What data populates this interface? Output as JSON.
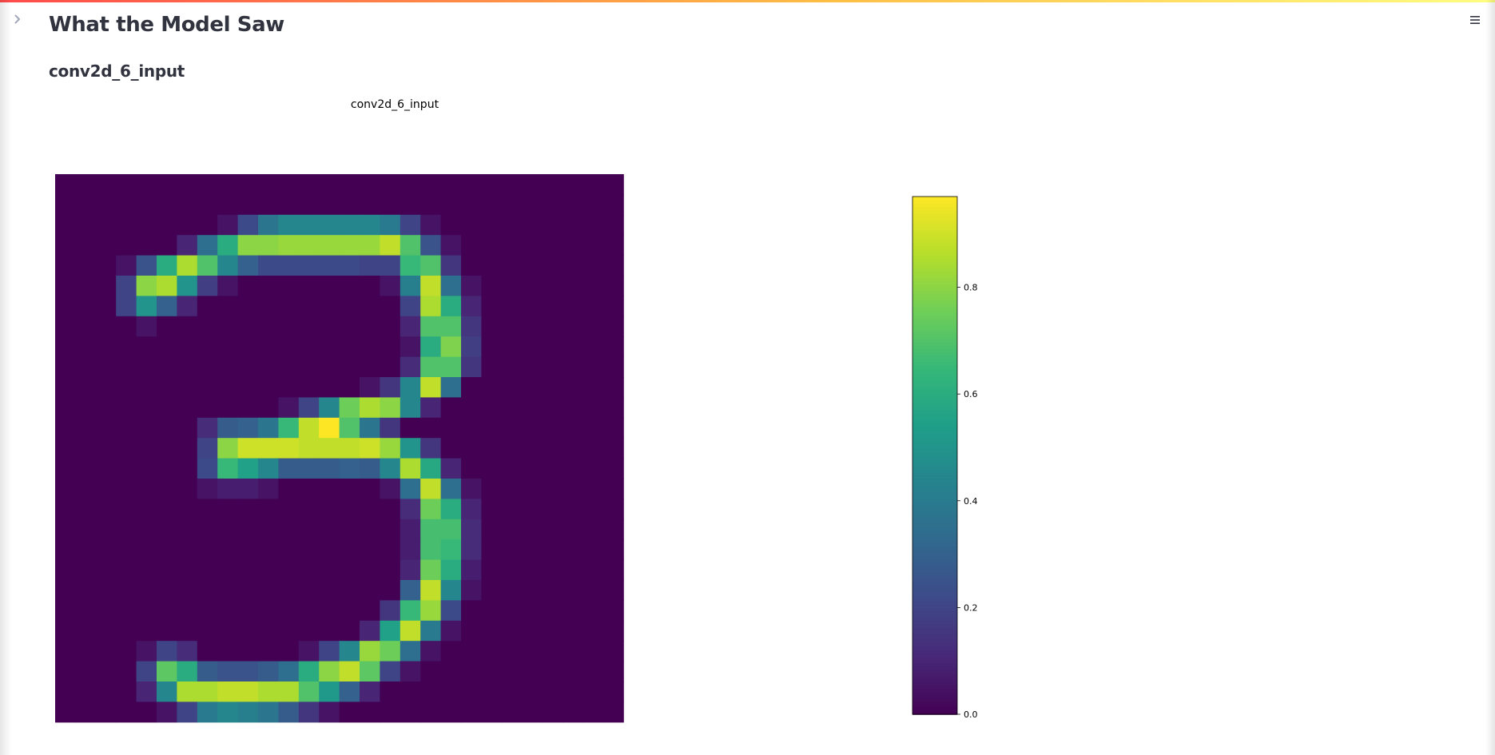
{
  "app": {
    "title": "What the Model Saw",
    "section_heading": "conv2d_6_input"
  },
  "icons": {
    "sidebar_toggle": "chevron-right-icon",
    "main_menu": "hamburger-menu-icon"
  },
  "colors": {
    "accent_gradient": [
      "#ff4b4b",
      "#ffbd45",
      "#fffd80"
    ],
    "text": "#31333f",
    "colormap": "viridis"
  },
  "chart_data": {
    "type": "heatmap",
    "title": "conv2d_6_input",
    "colormap": "viridis",
    "colorbar": {
      "range": [
        0,
        0.97
      ],
      "ticks": [
        0.0,
        0.2,
        0.4,
        0.6,
        0.8
      ],
      "tick_labels": [
        "0.0",
        "0.2",
        "0.4",
        "0.6",
        "0.8"
      ]
    },
    "grid": false,
    "rows": 28,
    "cols": 28,
    "visible_rows": 27,
    "values": [
      [
        0,
        0,
        0,
        0,
        0,
        0,
        0,
        0,
        0,
        0,
        0,
        0,
        0,
        0,
        0,
        0,
        0,
        0,
        0,
        0,
        0,
        0,
        0,
        0,
        0,
        0,
        0,
        0
      ],
      [
        0,
        0,
        0,
        0,
        0,
        0,
        0,
        0,
        0,
        0,
        0,
        0,
        0,
        0,
        0,
        0,
        0,
        0,
        0,
        0,
        0,
        0,
        0,
        0,
        0,
        0,
        0,
        0
      ],
      [
        0,
        0,
        0,
        0,
        0,
        0,
        0,
        0,
        0.05,
        0.22,
        0.38,
        0.45,
        0.45,
        0.45,
        0.45,
        0.45,
        0.4,
        0.2,
        0.05,
        0,
        0,
        0,
        0,
        0,
        0,
        0,
        0,
        0
      ],
      [
        0,
        0,
        0,
        0,
        0,
        0,
        0.1,
        0.35,
        0.6,
        0.8,
        0.8,
        0.82,
        0.82,
        0.82,
        0.82,
        0.82,
        0.88,
        0.7,
        0.25,
        0.05,
        0,
        0,
        0,
        0,
        0,
        0,
        0,
        0
      ],
      [
        0,
        0,
        0,
        0.05,
        0.25,
        0.6,
        0.85,
        0.7,
        0.45,
        0.3,
        0.22,
        0.22,
        0.22,
        0.22,
        0.22,
        0.2,
        0.2,
        0.65,
        0.7,
        0.15,
        0,
        0,
        0,
        0,
        0,
        0,
        0,
        0
      ],
      [
        0,
        0,
        0,
        0.2,
        0.8,
        0.85,
        0.5,
        0.18,
        0.05,
        0,
        0,
        0,
        0,
        0,
        0,
        0,
        0.05,
        0.42,
        0.88,
        0.35,
        0.05,
        0,
        0,
        0,
        0,
        0,
        0,
        0
      ],
      [
        0,
        0,
        0,
        0.2,
        0.5,
        0.3,
        0.1,
        0,
        0,
        0,
        0,
        0,
        0,
        0,
        0,
        0,
        0,
        0.2,
        0.85,
        0.6,
        0.1,
        0,
        0,
        0,
        0,
        0,
        0,
        0
      ],
      [
        0,
        0,
        0,
        0,
        0.05,
        0,
        0,
        0,
        0,
        0,
        0,
        0,
        0,
        0,
        0,
        0,
        0,
        0.1,
        0.7,
        0.7,
        0.15,
        0,
        0,
        0,
        0,
        0,
        0,
        0
      ],
      [
        0,
        0,
        0,
        0,
        0,
        0,
        0,
        0,
        0,
        0,
        0,
        0,
        0,
        0,
        0,
        0,
        0,
        0.05,
        0.6,
        0.78,
        0.18,
        0,
        0,
        0,
        0,
        0,
        0,
        0
      ],
      [
        0,
        0,
        0,
        0,
        0,
        0,
        0,
        0,
        0,
        0,
        0,
        0,
        0,
        0,
        0,
        0,
        0,
        0.12,
        0.7,
        0.7,
        0.15,
        0,
        0,
        0,
        0,
        0,
        0,
        0
      ],
      [
        0,
        0,
        0,
        0,
        0,
        0,
        0,
        0,
        0,
        0,
        0,
        0,
        0,
        0,
        0,
        0.05,
        0.15,
        0.45,
        0.88,
        0.35,
        0,
        0,
        0,
        0,
        0,
        0,
        0,
        0
      ],
      [
        0,
        0,
        0,
        0,
        0,
        0,
        0,
        0,
        0,
        0,
        0,
        0.05,
        0.2,
        0.45,
        0.75,
        0.85,
        0.8,
        0.45,
        0.1,
        0,
        0,
        0,
        0,
        0,
        0,
        0,
        0,
        0
      ],
      [
        0,
        0,
        0,
        0,
        0,
        0,
        0,
        0.12,
        0.28,
        0.3,
        0.38,
        0.65,
        0.88,
        0.97,
        0.7,
        0.38,
        0.15,
        0,
        0,
        0,
        0,
        0,
        0,
        0,
        0,
        0,
        0,
        0
      ],
      [
        0,
        0,
        0,
        0,
        0,
        0,
        0,
        0.2,
        0.8,
        0.9,
        0.9,
        0.9,
        0.88,
        0.88,
        0.88,
        0.9,
        0.82,
        0.5,
        0.15,
        0,
        0,
        0,
        0,
        0,
        0,
        0,
        0,
        0
      ],
      [
        0,
        0,
        0,
        0,
        0,
        0,
        0,
        0.22,
        0.65,
        0.55,
        0.45,
        0.28,
        0.28,
        0.28,
        0.3,
        0.28,
        0.45,
        0.85,
        0.58,
        0.1,
        0,
        0,
        0,
        0,
        0,
        0,
        0,
        0
      ],
      [
        0,
        0,
        0,
        0,
        0,
        0,
        0,
        0.05,
        0.08,
        0.08,
        0.05,
        0,
        0,
        0,
        0,
        0,
        0.05,
        0.35,
        0.88,
        0.35,
        0.05,
        0,
        0,
        0,
        0,
        0,
        0,
        0
      ],
      [
        0,
        0,
        0,
        0,
        0,
        0,
        0,
        0,
        0,
        0,
        0,
        0,
        0,
        0,
        0,
        0,
        0,
        0.12,
        0.75,
        0.6,
        0.1,
        0,
        0,
        0,
        0,
        0,
        0,
        0
      ],
      [
        0,
        0,
        0,
        0,
        0,
        0,
        0,
        0,
        0,
        0,
        0,
        0,
        0,
        0,
        0,
        0,
        0,
        0.08,
        0.68,
        0.68,
        0.12,
        0,
        0,
        0,
        0,
        0,
        0,
        0
      ],
      [
        0,
        0,
        0,
        0,
        0,
        0,
        0,
        0,
        0,
        0,
        0,
        0,
        0,
        0,
        0,
        0,
        0,
        0.08,
        0.68,
        0.65,
        0.12,
        0,
        0,
        0,
        0,
        0,
        0,
        0
      ],
      [
        0,
        0,
        0,
        0,
        0,
        0,
        0,
        0,
        0,
        0,
        0,
        0,
        0,
        0,
        0,
        0,
        0,
        0.1,
        0.75,
        0.6,
        0.08,
        0,
        0,
        0,
        0,
        0,
        0,
        0
      ],
      [
        0,
        0,
        0,
        0,
        0,
        0,
        0,
        0,
        0,
        0,
        0,
        0,
        0,
        0,
        0,
        0,
        0,
        0.3,
        0.88,
        0.45,
        0.05,
        0,
        0,
        0,
        0,
        0,
        0,
        0
      ],
      [
        0,
        0,
        0,
        0,
        0,
        0,
        0,
        0,
        0,
        0,
        0,
        0,
        0,
        0,
        0,
        0,
        0.15,
        0.65,
        0.82,
        0.22,
        0,
        0,
        0,
        0,
        0,
        0,
        0,
        0
      ],
      [
        0,
        0,
        0,
        0,
        0,
        0,
        0,
        0,
        0,
        0,
        0,
        0,
        0,
        0,
        0,
        0.1,
        0.55,
        0.88,
        0.4,
        0.05,
        0,
        0,
        0,
        0,
        0,
        0,
        0,
        0
      ],
      [
        0,
        0,
        0,
        0,
        0.05,
        0.2,
        0.12,
        0,
        0,
        0,
        0,
        0,
        0.05,
        0.2,
        0.45,
        0.82,
        0.75,
        0.35,
        0.05,
        0,
        0,
        0,
        0,
        0,
        0,
        0,
        0,
        0
      ],
      [
        0,
        0,
        0,
        0,
        0.2,
        0.72,
        0.6,
        0.28,
        0.25,
        0.25,
        0.28,
        0.35,
        0.6,
        0.8,
        0.88,
        0.72,
        0.2,
        0.05,
        0,
        0,
        0,
        0,
        0,
        0,
        0,
        0,
        0,
        0
      ],
      [
        0,
        0,
        0,
        0,
        0.1,
        0.45,
        0.85,
        0.85,
        0.88,
        0.88,
        0.85,
        0.85,
        0.7,
        0.52,
        0.3,
        0.1,
        0,
        0,
        0,
        0,
        0,
        0,
        0,
        0,
        0,
        0,
        0,
        0
      ],
      [
        0,
        0,
        0,
        0,
        0,
        0.05,
        0.2,
        0.4,
        0.45,
        0.42,
        0.38,
        0.28,
        0.15,
        0.05,
        0,
        0,
        0,
        0,
        0,
        0,
        0,
        0,
        0,
        0,
        0,
        0,
        0,
        0
      ],
      [
        0,
        0,
        0,
        0,
        0,
        0,
        0,
        0,
        0,
        0,
        0,
        0,
        0,
        0,
        0,
        0,
        0,
        0,
        0,
        0,
        0,
        0,
        0,
        0,
        0,
        0,
        0,
        0
      ]
    ]
  }
}
